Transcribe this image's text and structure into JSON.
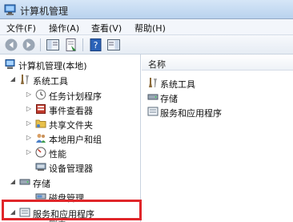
{
  "window": {
    "title": "计算机管理"
  },
  "menu": [
    "文件(F)",
    "操作(A)",
    "查看(V)",
    "帮助(H)"
  ],
  "toolbar": {
    "buttons": [
      "back-icon",
      "forward-icon",
      "show-tree-icon",
      "properties-icon",
      "help-icon",
      "action-pane-icon"
    ]
  },
  "tree": {
    "root": "计算机管理(本地)",
    "system_tools": "系统工具",
    "items": [
      "任务计划程序",
      "事件查看器",
      "共享文件夹",
      "本地用户和组",
      "性能",
      "设备管理器"
    ],
    "storage": "存储",
    "disk_mgmt": "磁盘管理",
    "services": "服务和应用程序",
    "partial_next": "服务"
  },
  "list": {
    "header": "名称",
    "rows": [
      "系统工具",
      "存储",
      "服务和应用程序"
    ]
  }
}
